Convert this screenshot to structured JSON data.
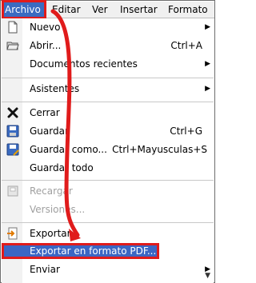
{
  "menubar": {
    "items": [
      {
        "label": "Archivo",
        "active": true
      },
      {
        "label": "Editar"
      },
      {
        "label": "Ver"
      },
      {
        "label": "Insertar"
      },
      {
        "label": "Formato"
      }
    ]
  },
  "file_menu": {
    "items": [
      {
        "label": "Nuevo",
        "icon": "new-document-icon",
        "submenu": true
      },
      {
        "label": "Abrir...",
        "icon": "open-folder-icon",
        "shortcut": "Ctrl+A"
      },
      {
        "label": "Documentos recientes",
        "submenu": true
      },
      {
        "label": "Asistentes",
        "submenu": true
      },
      {
        "label": "Cerrar",
        "icon": "close-icon"
      },
      {
        "label": "Guardar",
        "icon": "save-icon",
        "shortcut": "Ctrl+G"
      },
      {
        "label": "Guardar como...",
        "icon": "save-as-icon",
        "shortcut": "Ctrl+Mayusculas+S"
      },
      {
        "label": "Guardar todo"
      },
      {
        "label": "Recargar",
        "icon": "reload-icon",
        "disabled": true
      },
      {
        "label": "Versiones...",
        "disabled": true
      },
      {
        "label": "Exportar...",
        "icon": "export-icon"
      },
      {
        "label": "Exportar en formato PDF...",
        "highlighted": true
      },
      {
        "label": "Enviar",
        "submenu": true
      }
    ]
  },
  "colors": {
    "highlight": "#3b66c4",
    "callout_red": "#e01b1b",
    "disabled_text": "#a0a0a0"
  },
  "glyphs": {
    "submenu_arrow": "▶",
    "more_chevron": "▼"
  }
}
